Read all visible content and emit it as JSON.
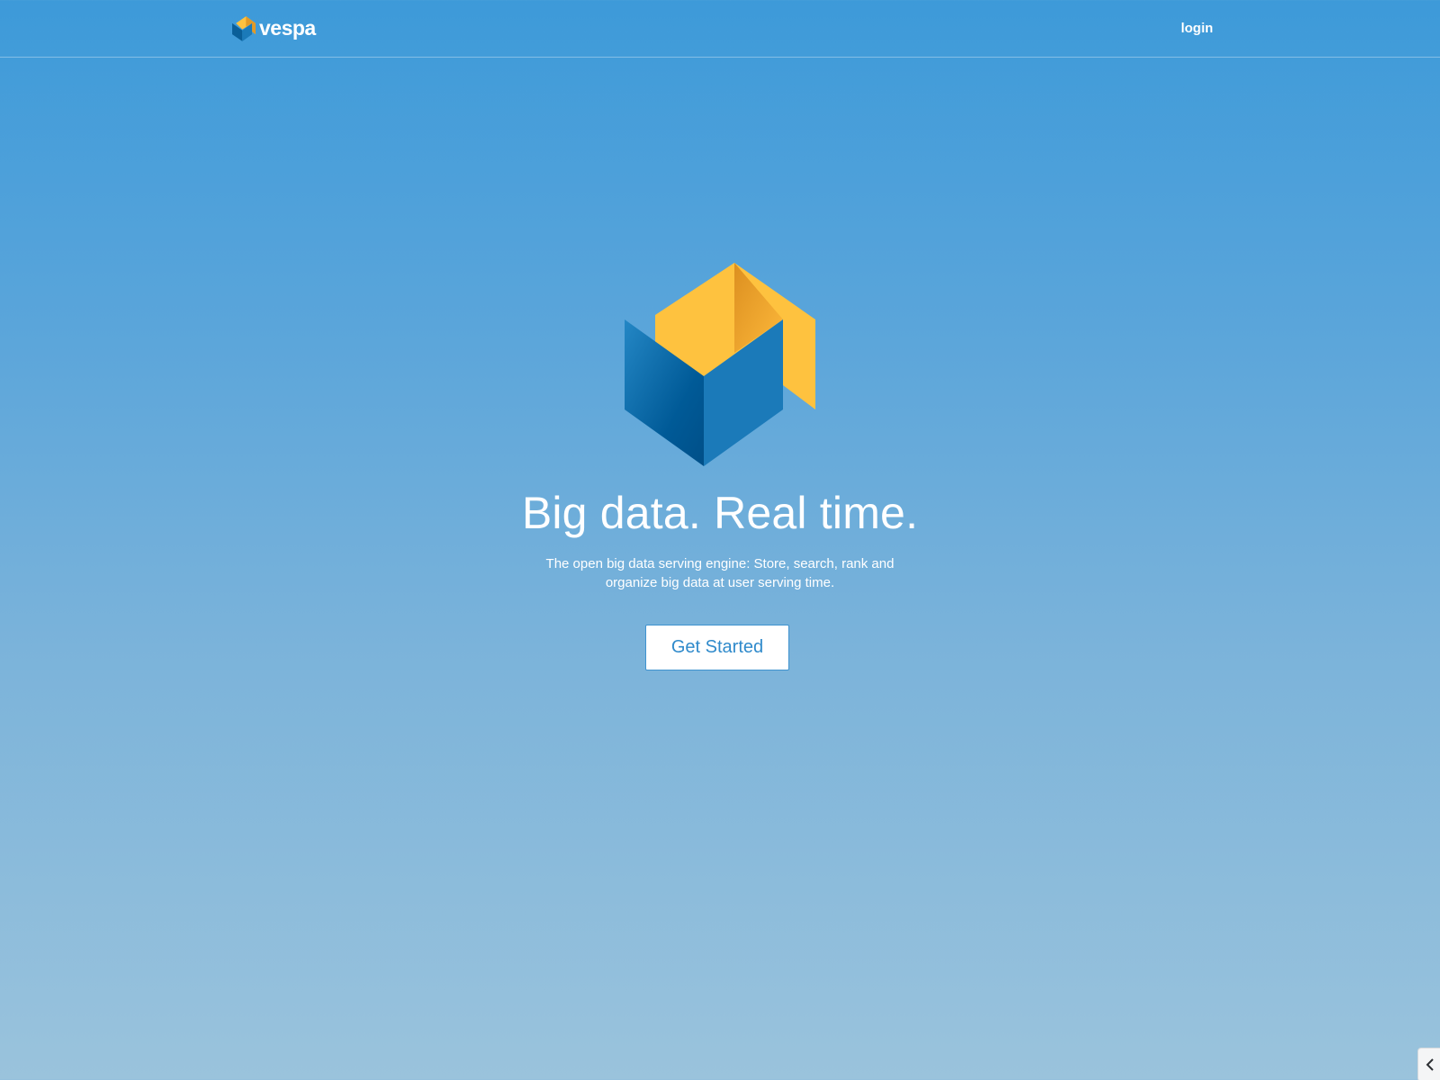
{
  "header": {
    "brand_name": "vespa",
    "brand_icon": "vespa-cube-logo-icon",
    "login_label": "login"
  },
  "hero": {
    "logo_icon": "vespa-cube-logo-icon",
    "title": "Big data. Real time.",
    "subtitle": "The open big data serving engine: Store, search, rank and organize big data at user serving time.",
    "cta_label": "Get Started"
  },
  "side_tab": {
    "icon": "chevron-left-icon"
  },
  "colors": {
    "background_top": "#3d9ad9",
    "background_bottom": "#9ac3dc",
    "logo_yellow": "#fec23f",
    "logo_orange": "#e29a27",
    "logo_blue": "#1b7ab9",
    "logo_dark_blue": "#005b97",
    "cta_text": "#2f8acb"
  }
}
